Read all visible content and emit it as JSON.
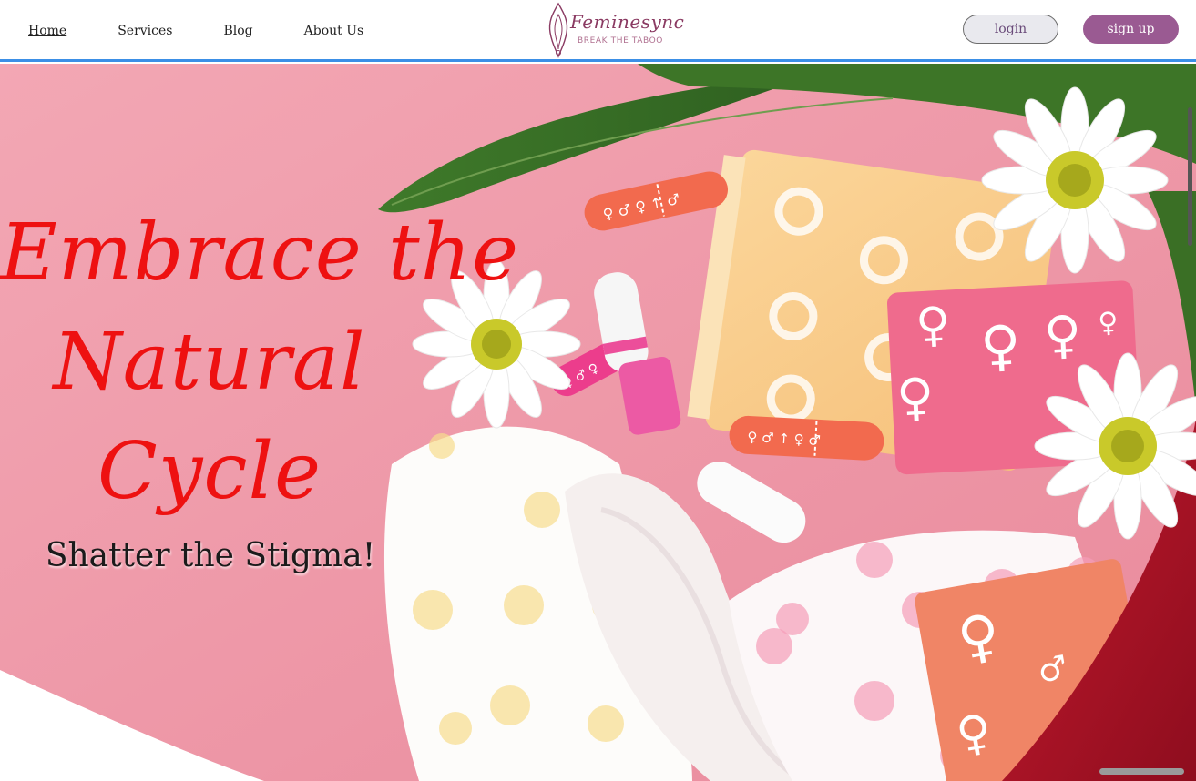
{
  "header": {
    "nav": [
      {
        "label": "Home",
        "active": true
      },
      {
        "label": "Services",
        "active": false
      },
      {
        "label": "Blog",
        "active": false
      },
      {
        "label": "About Us",
        "active": false
      }
    ],
    "logo": {
      "name": "Feminesync",
      "tagline": "BREAK THE TABOO"
    },
    "login_label": "login",
    "signup_label": "sign up"
  },
  "hero": {
    "headline_lines": [
      "Embrace  the",
      "Natural",
      "Cycle"
    ],
    "subheadline": "Shatter the Stigma!",
    "image_icon": "menstrual-products-photo"
  },
  "colors": {
    "accent_blue": "#3b8fe6",
    "headline_red": "#ee1111",
    "hero_pink": "#ee9aaa",
    "signup_purple": "#9a5a92"
  }
}
